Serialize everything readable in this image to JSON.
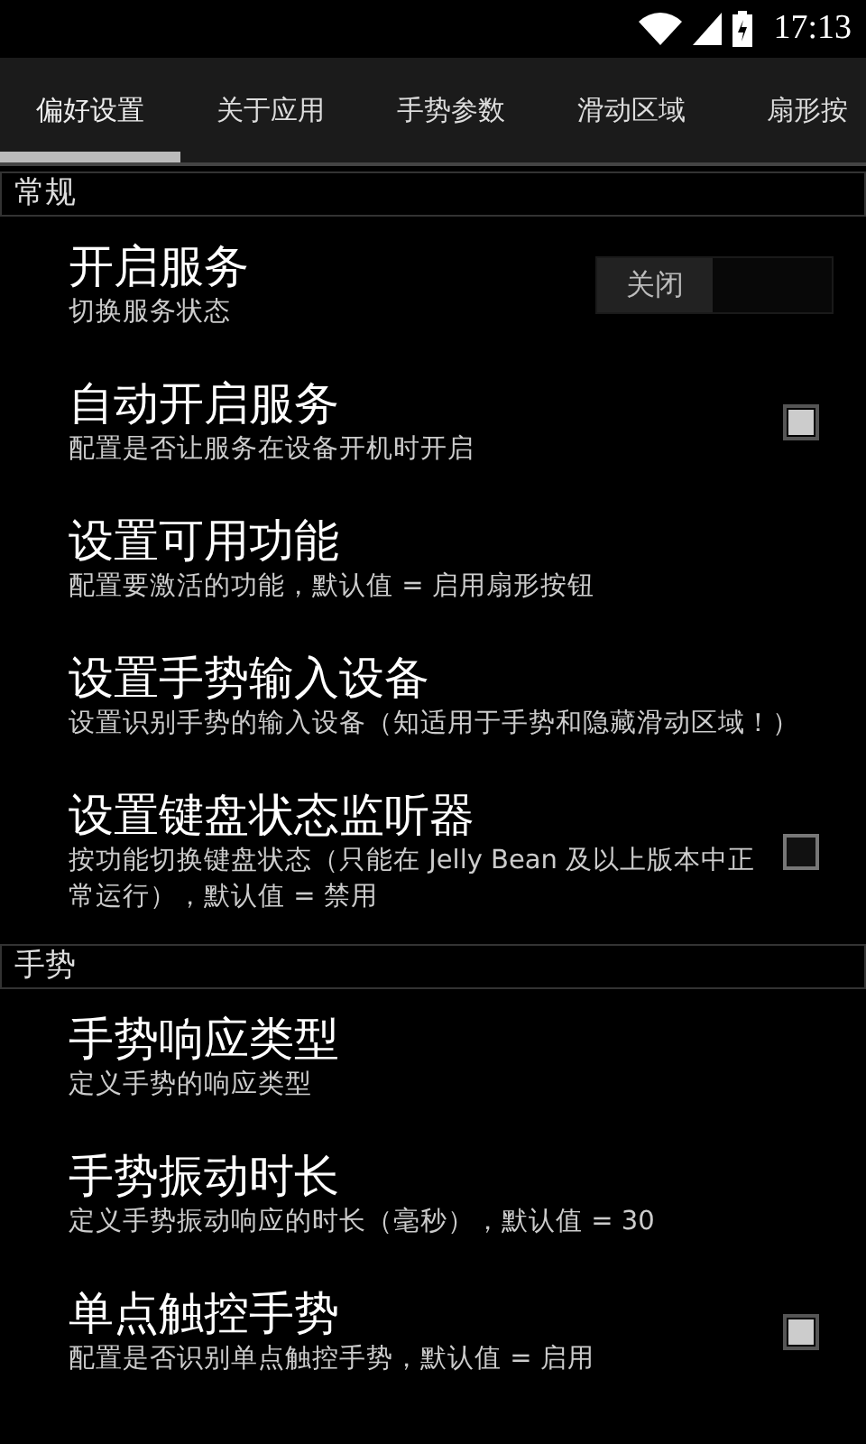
{
  "status_bar": {
    "time": "17:13"
  },
  "tabs": [
    {
      "label": "偏好设置",
      "selected": true
    },
    {
      "label": "关于应用",
      "selected": false
    },
    {
      "label": "手势参数",
      "selected": false
    },
    {
      "label": "滑动区域",
      "selected": false
    },
    {
      "label": "扇形按",
      "selected": false
    }
  ],
  "sections": [
    {
      "title": "常规",
      "items": [
        {
          "kind": "toggle",
          "title": "开启服务",
          "subtitle": "切换服务状态",
          "on": false,
          "toggle_label": "关闭"
        },
        {
          "kind": "checkbox",
          "title": "自动开启服务",
          "subtitle": "配置是否让服务在设备开机时开启",
          "checked": true
        },
        {
          "kind": "plain",
          "title": "设置可用功能",
          "subtitle": "配置要激活的功能，默认值 = 启用扇形按钮"
        },
        {
          "kind": "plain",
          "title": "设置手势输入设备",
          "subtitle": "设置识别手势的输入设备（知适用于手势和隐藏滑动区域！）"
        },
        {
          "kind": "checkbox",
          "title": "设置键盘状态监听器",
          "subtitle": "按功能切换键盘状态（只能在 Jelly Bean 及以上版本中正常运行），默认值 = 禁用",
          "checked": false
        }
      ]
    },
    {
      "title": "手势",
      "items": [
        {
          "kind": "plain",
          "title": "手势响应类型",
          "subtitle": "定义手势的响应类型"
        },
        {
          "kind": "plain",
          "title": "手势振动时长",
          "subtitle": "定义手势振动响应的时长（毫秒），默认值 = 30"
        },
        {
          "kind": "checkbox",
          "title": "单点触控手势",
          "subtitle": "配置是否识别单点触控手势，默认值 = 启用",
          "checked": true
        }
      ]
    }
  ]
}
